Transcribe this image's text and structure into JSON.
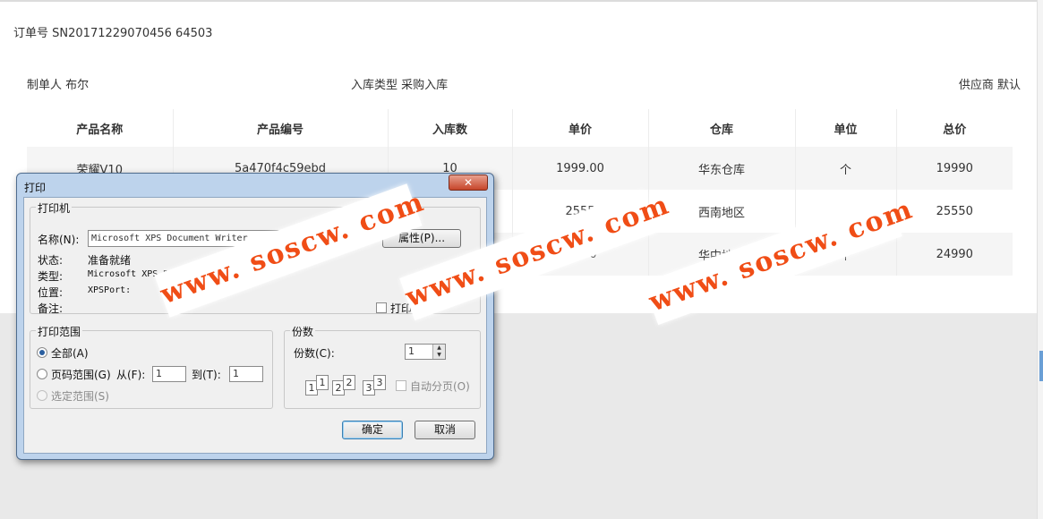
{
  "order": {
    "label": "订单号",
    "number": "SN20171229070456 64503"
  },
  "meta": {
    "creator": "制单人 布尔",
    "inbound_type": "入库类型 采购入库",
    "supplier": "供应商 默认"
  },
  "table": {
    "headers": [
      "产品名称",
      "产品编号",
      "入库数",
      "单价",
      "仓库",
      "单位",
      "总价"
    ],
    "rows": [
      [
        "荣耀V10",
        "5a470f4c59ebd",
        "10",
        "1999.00",
        "华东仓库",
        "个",
        "19990"
      ],
      [
        "",
        "",
        "",
        "2555",
        "西南地区",
        "",
        "25550"
      ],
      [
        "",
        "",
        "",
        "99.00",
        "华中地区",
        "个",
        "24990"
      ]
    ]
  },
  "dialog": {
    "title": "打印",
    "close": "✕",
    "printer_group": "打印机",
    "name_label": "名称(N):",
    "printer_name": "Microsoft XPS Document Writer",
    "properties_button": "属性(P)...",
    "status_label": "状态:",
    "status_value": "准备就绪",
    "type_label": "类型:",
    "type_value": "Microsoft XPS Document W",
    "where_label": "位置:",
    "where_value": "XPSPort:",
    "comment_label": "备注:",
    "print_to_file": "打印",
    "range_group": "打印范围",
    "all": "全部(A)",
    "pages": "页码范围(G)",
    "from_label": "从(F):",
    "from_value": "1",
    "to_label": "到(T):",
    "to_value": "1",
    "selection": "选定范围(S)",
    "copies_group": "份数",
    "copies_label": "份数(C):",
    "copies_value": "1",
    "collate": "自动分页(O)",
    "collate_digits": [
      "1",
      "1",
      "2",
      "2",
      "3",
      "3"
    ],
    "ok": "确定",
    "cancel": "取消"
  },
  "watermark": [
    "www. soscw. com",
    "www. soscw. com",
    "www. soscw. com"
  ]
}
